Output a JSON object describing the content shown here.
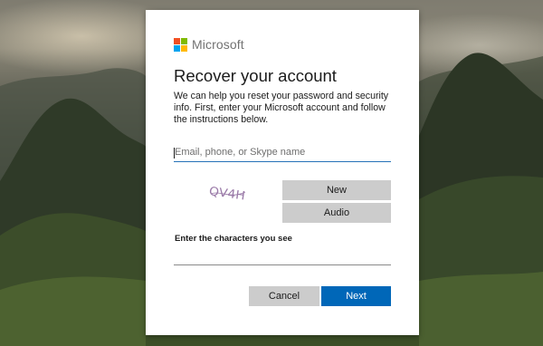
{
  "brand": {
    "name": "Microsoft"
  },
  "page": {
    "title": "Recover your account",
    "description": "We can help you reset your password and security info. First, enter your Microsoft account and follow the instructions below."
  },
  "email": {
    "placeholder": "Email, phone, or Skype name",
    "value": ""
  },
  "captcha": {
    "image_text": "QV4H",
    "new_label": "New",
    "audio_label": "Audio",
    "prompt": "Enter the characters you see",
    "value": ""
  },
  "actions": {
    "cancel_label": "Cancel",
    "next_label": "Next"
  },
  "colors": {
    "primary": "#0067b8",
    "secondary_button": "#cccccc",
    "input_focus": "#2672b8",
    "logo_red": "#f25022",
    "logo_green": "#7fba00",
    "logo_blue": "#00a4ef",
    "logo_yellow": "#ffb900"
  },
  "icons": {
    "logo": "microsoft-logo-icon",
    "captcha": "captcha-image"
  }
}
